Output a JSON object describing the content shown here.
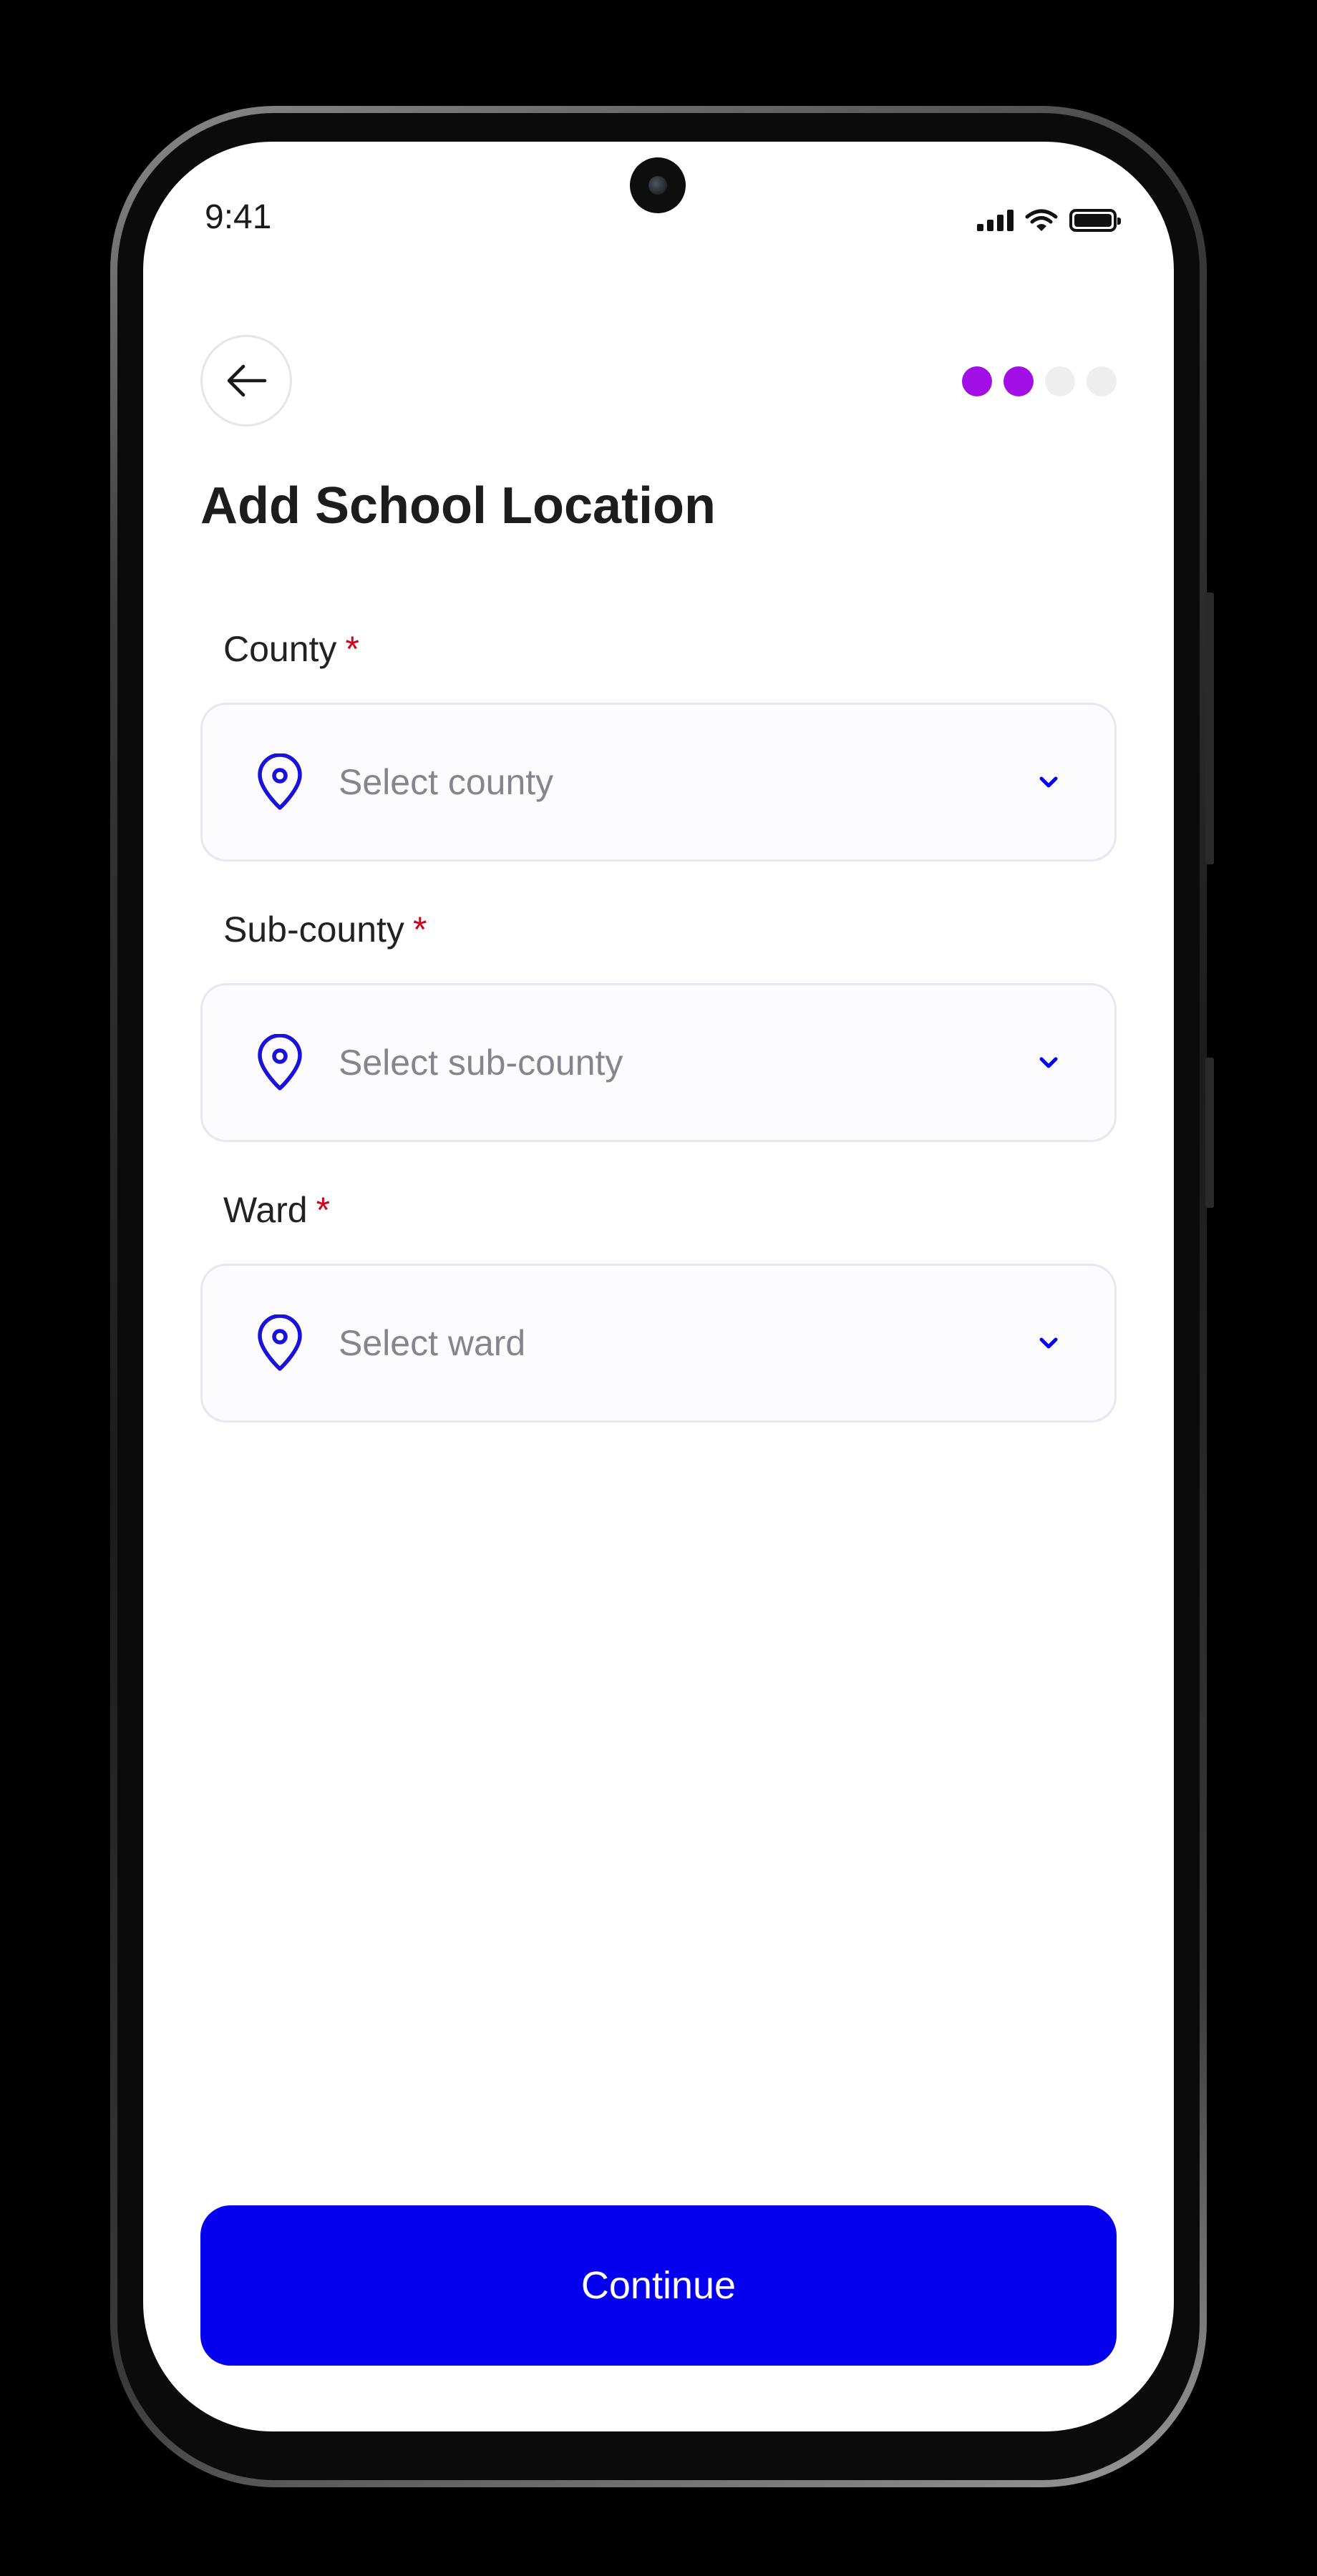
{
  "status_bar": {
    "time": "9:41"
  },
  "header": {
    "back_icon": "arrow-left-icon",
    "progress": {
      "total_steps": 4,
      "completed_steps": 2,
      "active_color": "#A10FE6",
      "inactive_color": "#EEEEEE"
    }
  },
  "page": {
    "title": "Add School Location"
  },
  "fields": [
    {
      "label": "County",
      "required_mark": "*",
      "placeholder": "Select county",
      "icon": "location-pin-icon"
    },
    {
      "label": "Sub-county",
      "required_mark": "*",
      "placeholder": "Select sub-county",
      "icon": "location-pin-icon"
    },
    {
      "label": "Ward",
      "required_mark": "*",
      "placeholder": "Select ward",
      "icon": "location-pin-icon"
    }
  ],
  "footer": {
    "continue_label": "Continue"
  },
  "colors": {
    "accent": "#0500EE",
    "required": "#D0021B",
    "progress_active": "#A10FE6"
  }
}
